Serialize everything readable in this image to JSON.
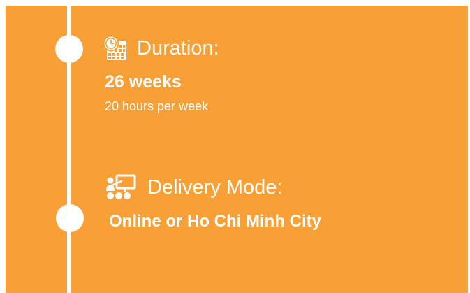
{
  "theme": {
    "panel_color": "#f89f35",
    "accent_color": "#ffffff"
  },
  "duration": {
    "icon": "calendar-clock-icon",
    "heading": "Duration:",
    "value": "26 weeks",
    "detail": "20 hours per week"
  },
  "delivery": {
    "icon": "classroom-presentation-icon",
    "heading": "Delivery Mode:",
    "value": "Online or Ho Chi Minh City"
  }
}
